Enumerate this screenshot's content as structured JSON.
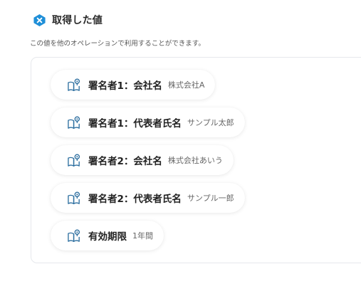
{
  "section": {
    "title": "取得した値",
    "description": "この値を他のオペレーションで利用することができます。"
  },
  "colors": {
    "badge": "#1f8fd8",
    "icon_stroke": "#2d6fa0"
  },
  "items": [
    {
      "label": "署名者1：会社名",
      "value": "株式会社A",
      "icon": "book-search-icon"
    },
    {
      "label": "署名者1：代表者氏名",
      "value": "サンプル太郎",
      "icon": "book-search-icon"
    },
    {
      "label": "署名者2：会社名",
      "value": "株式会社あいう",
      "icon": "book-search-icon"
    },
    {
      "label": "署名者2：代表者氏名",
      "value": "サンプル一郎",
      "icon": "book-search-icon"
    },
    {
      "label": "有効期限",
      "value": "1年間",
      "icon": "book-search-icon"
    }
  ]
}
